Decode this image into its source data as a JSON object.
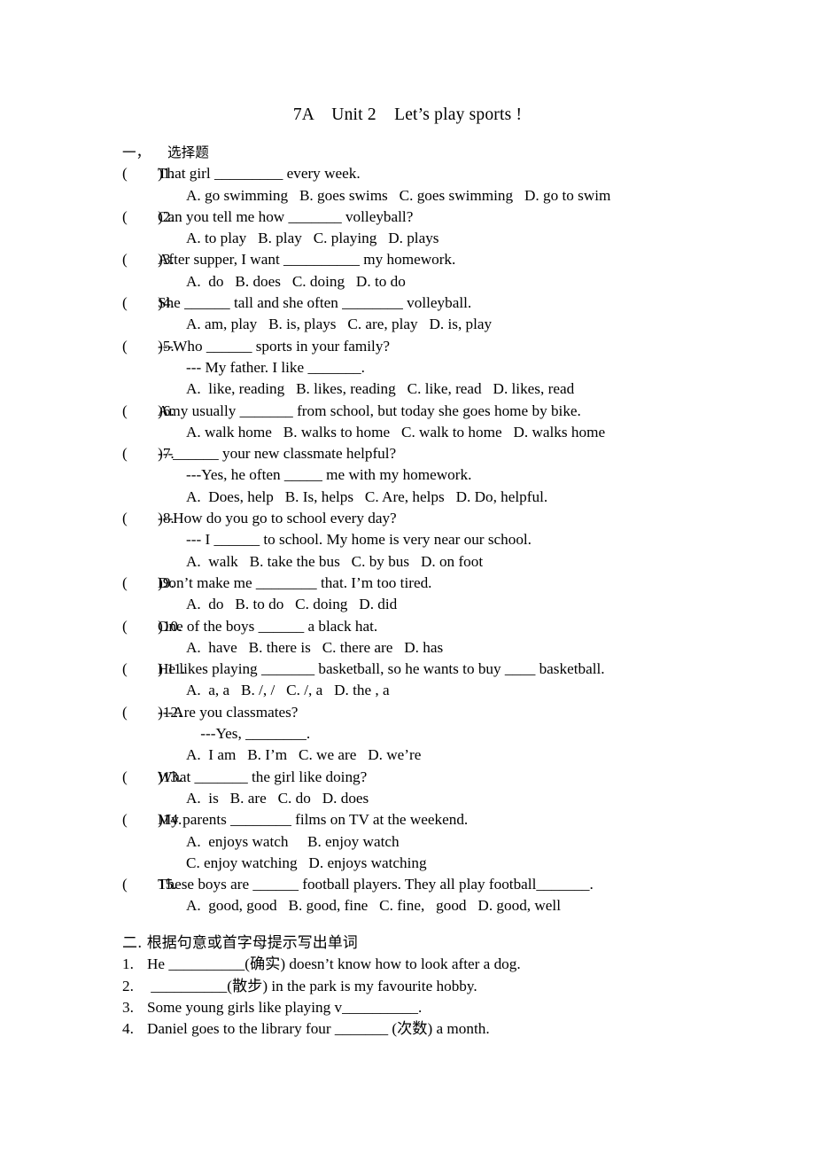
{
  "document": {
    "title": "7A    Unit 2    Let’s play sports !"
  },
  "section_one": {
    "heading": "一，    选择题",
    "questions": [
      {
        "marker": "(        )1.",
        "stem": "That girl _________ every week.",
        "continuation": null,
        "options": [
          "A. go swimming   B. goes swims   C. goes swimming   D. go to swim"
        ]
      },
      {
        "marker": "(        )2.",
        "stem": "Can you tell me how _______ volleyball?",
        "continuation": null,
        "options": [
          "A. to play   B. play   C. playing   D. plays"
        ]
      },
      {
        "marker": "(        )3.",
        "stem": "After supper, I want __________ my homework.",
        "continuation": null,
        "options": [
          "A.  do   B. does   C. doing   D. to do"
        ]
      },
      {
        "marker": "(        )4.",
        "stem": "She ______ tall and she often ________ volleyball.",
        "continuation": null,
        "options": [
          "A. am, play   B. is, plays   C. are, play   D. is, play"
        ]
      },
      {
        "marker": "(        )5.",
        "stem": "---Who ______ sports in your family?",
        "continuation": "--- My father. I like _______.",
        "options": [
          "A.  like, reading   B. likes, reading   C. like, read   D. likes, read"
        ]
      },
      {
        "marker": "(        )6.",
        "stem": "Amy usually _______ from school, but today she goes home by bike.",
        "continuation": null,
        "options": [
          "A. walk home   B. walks to home   C. walk to home   D. walks home"
        ]
      },
      {
        "marker": "(        )7.",
        "stem": "---______ your new classmate helpful?",
        "continuation": "---Yes, he often _____ me with my homework.",
        "options": [
          "A.  Does, help   B. Is, helps   C. Are, helps   D. Do, helpful."
        ]
      },
      {
        "marker": "(        )8.",
        "stem": "---How do you go to school every day?",
        "continuation": "--- I ______ to school. My home is very near our school.",
        "options": [
          "A.  walk   B. take the bus   C. by bus   D. on foot"
        ]
      },
      {
        "marker": "(        )9.",
        "stem": "Don’t make me ________ that. I’m too tired.",
        "continuation": null,
        "options": [
          "A.  do   B. to do   C. doing   D. did"
        ]
      },
      {
        "marker": "(        )10.",
        "stem": "One of the boys ______ a black hat.",
        "continuation": null,
        "options": [
          "A.  have   B. there is   C. there are   D. has"
        ]
      },
      {
        "marker": "(        ) 11.",
        "stem": "He likes playing _______ basketball, so he wants to buy ____ basketball.",
        "continuation": null,
        "options": [
          "A.  a, a   B. /, /   C. /, a   D. the , a"
        ]
      },
      {
        "marker": "(        )12.",
        "stem": "---Are you classmates?",
        "continuation": " ---Yes, ________.",
        "options": [
          "A.  I am   B. I’m   C. we are   D. we’re"
        ]
      },
      {
        "marker": "(        )13.",
        "stem": "What _______ the girl like doing?",
        "continuation": null,
        "options": [
          "A.  is   B. are   C. do   D. does"
        ]
      },
      {
        "marker": "(        )14.",
        "stem": "My parents ________ films on TV at the weekend.",
        "continuation": null,
        "options": [
          "A.  enjoys watch     B. enjoy watch",
          "C. enjoy watching   D. enjoys watching"
        ]
      },
      {
        "marker": "(        15.",
        "stem": "These boys are ______ football players. They all play football_______.",
        "continuation": null,
        "options": [
          "A.  good, good   B. good, fine   C. fine,   good   D. good, well"
        ]
      }
    ]
  },
  "section_two": {
    "heading": "二. 根据句意或首字母提示写出单词",
    "items": [
      {
        "number": "1.",
        "text": "He __________(确实) doesn’t know how to look after a dog."
      },
      {
        "number": "2.",
        "text": " __________(散步) in the park is my favourite hobby."
      },
      {
        "number": "3.",
        "text": "Some young girls like playing v__________."
      },
      {
        "number": "4.",
        "text": "Daniel goes to the library four _______ (次数) a month."
      }
    ]
  }
}
